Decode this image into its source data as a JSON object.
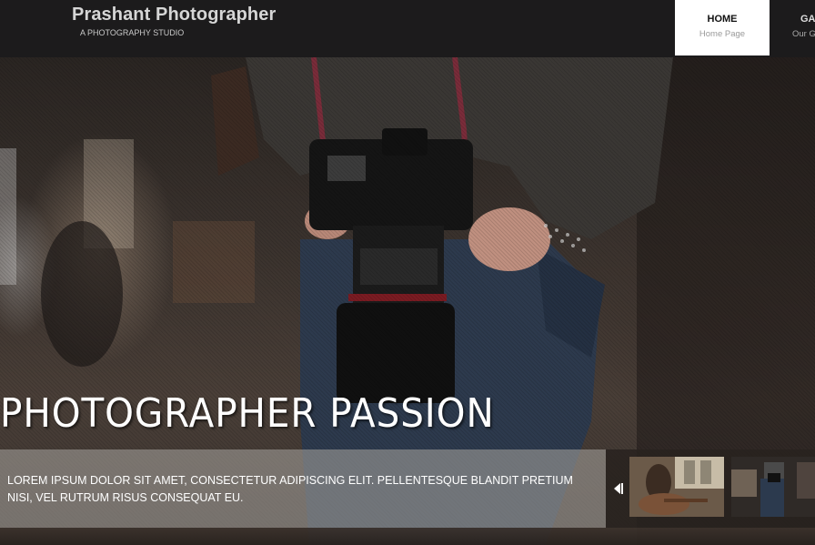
{
  "header": {
    "brand_title": "Prashant Photographer",
    "brand_subtitle": "A PHOTOGRAPHY STUDIO",
    "nav": [
      {
        "label": "HOME",
        "sub": "Home Page"
      },
      {
        "label": "GAI",
        "sub": "Our G"
      }
    ]
  },
  "slider": {
    "title": "PHOTOGRAPHER PASSION",
    "caption": "LOREM IPSUM DOLOR SIT AMET, CONSECTETUR ADIPISCING ELIT. PELLENTESQUE BLANDIT PRETIUM NISI, VEL RUTRUM RISUS CONSEQUAT EU."
  },
  "colors": {
    "header_bg": "#1c1b1c",
    "active_nav_bg": "#ffffff",
    "caption_overlay": "rgba(170,165,160,0.55)"
  }
}
